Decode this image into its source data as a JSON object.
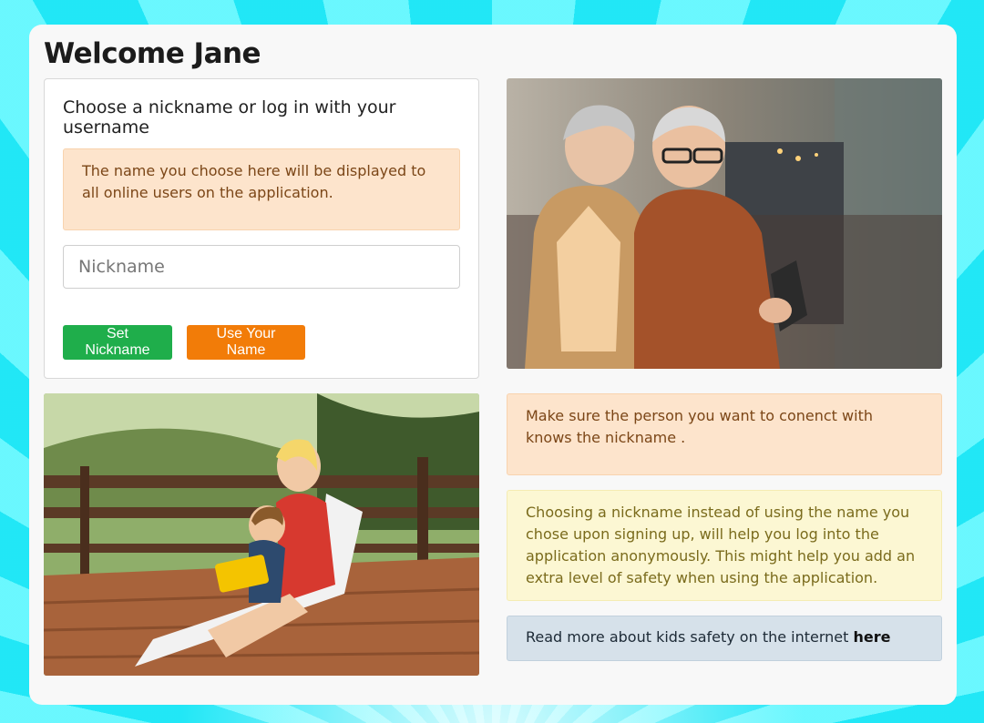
{
  "page": {
    "title": "Welcome Jane"
  },
  "form": {
    "heading": "Choose a nickname or log in with your username",
    "notice": "The name you choose here will be displayed to all online users on the application.",
    "nickname_placeholder": "Nickname",
    "nickname_value": "",
    "set_nickname_label": "Set Nickname",
    "use_name_label": "Use Your Name"
  },
  "info": {
    "connect_notice": "Make sure the person you want to conenct with knows the nickname .",
    "anonymity_notice": "Choosing a nickname instead of using the name you chose upon signing up, will help you log into the application anonymously. This might help you add an extra level of safety when using the application.",
    "read_more_text": "Read more about kids safety on the internet ",
    "read_more_link": "here"
  },
  "colors": {
    "background": "#3ff2fb",
    "set_nickname_button": "#1fae4b",
    "use_name_button": "#f27c08",
    "orange_alert": "#fde4cc",
    "yellow_alert": "#fcf7d3",
    "blue_alert": "#d6e1ea"
  }
}
